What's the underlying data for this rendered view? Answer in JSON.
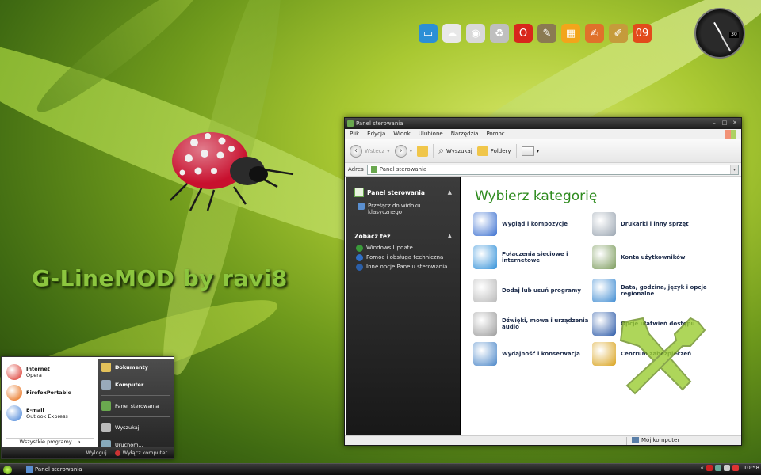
{
  "desktop": {
    "watermark": "G-LineMOD by ravi8"
  },
  "clock": {
    "date": "30"
  },
  "dock": {
    "items": [
      {
        "icon": "monitor-icon",
        "color": "#2b8fd6",
        "glyph": "▭"
      },
      {
        "icon": "cloud-icon",
        "color": "#e8e8e8",
        "glyph": "☁"
      },
      {
        "icon": "disc-icon",
        "color": "#d9d9d9",
        "glyph": "◉"
      },
      {
        "icon": "recycle-bin-icon",
        "color": "#bfbfbf",
        "glyph": "♻"
      },
      {
        "icon": "opera-icon",
        "color": "#d8261c",
        "glyph": "O"
      },
      {
        "icon": "gimp-icon",
        "color": "#8a7a52",
        "glyph": "✎"
      },
      {
        "icon": "film-icon",
        "color": "#f2a51b",
        "glyph": "▦"
      },
      {
        "icon": "pencil-icon",
        "color": "#e0712b",
        "glyph": "✍"
      },
      {
        "icon": "brush-icon",
        "color": "#c59b3b",
        "glyph": "✐"
      },
      {
        "icon": "office-icon",
        "color": "#e24b1b",
        "glyph": "09"
      }
    ]
  },
  "window": {
    "title": "Panel sterowania",
    "menu": [
      "Plik",
      "Edycja",
      "Widok",
      "Ulubione",
      "Narzędzia",
      "Pomoc"
    ],
    "toolbar": {
      "back": "Wstecz",
      "search": "Wyszukaj",
      "folders": "Foldery"
    },
    "address": {
      "label": "Adres",
      "value": "Panel sterowania"
    },
    "sidebar": {
      "panel_title": "Panel sterowania",
      "switch_view": "Przełącz do widoku klasycznego",
      "see_also_title": "Zobacz też",
      "links": [
        "Windows Update",
        "Pomoc i obsługa techniczna",
        "Inne opcje Panelu sterowania"
      ]
    },
    "main": {
      "heading": "Wybierz kategorię",
      "categories": [
        {
          "label": "Wygląd i kompozycje",
          "icon": "appearance-icon",
          "color": "#3a6fd0"
        },
        {
          "label": "Drukarki i inny sprzęt",
          "icon": "printer-icon",
          "color": "#9aa5b1"
        },
        {
          "label": "Połączenia sieciowe i internetowe",
          "icon": "network-icon",
          "color": "#2f8fd8"
        },
        {
          "label": "Konta użytkowników",
          "icon": "users-icon",
          "color": "#7a9a5a"
        },
        {
          "label": "Dodaj lub usuń programy",
          "icon": "add-remove-icon",
          "color": "#b8b8b8"
        },
        {
          "label": "Data, godzina, język i opcje regionalne",
          "icon": "globe-calendar-icon",
          "color": "#3c8ad1"
        },
        {
          "label": "Dźwięki, mowa i urządzenia audio",
          "icon": "speaker-icon",
          "color": "#9c9c9c"
        },
        {
          "label": "Opcje ułatwień dostępu",
          "icon": "accessibility-icon",
          "color": "#2c5aa8"
        },
        {
          "label": "Wydajność i konserwacja",
          "icon": "performance-icon",
          "color": "#4a86c8"
        },
        {
          "label": "Centrum zabezpieczeń",
          "icon": "security-shield-icon",
          "color": "#d9a21b"
        }
      ]
    },
    "status": {
      "location": "Mój komputer"
    }
  },
  "start_menu": {
    "pinned": [
      {
        "title": "Internet",
        "subtitle": "Opera",
        "icon": "opera-icon",
        "color": "#d8261c"
      },
      {
        "title": "FirefoxPortable",
        "subtitle": "",
        "icon": "firefox-icon",
        "color": "#e66000"
      },
      {
        "title": "E-mail",
        "subtitle": "Outlook Express",
        "icon": "mail-icon",
        "color": "#3a7bd5"
      }
    ],
    "all_programs": "Wszystkie programy",
    "right": [
      {
        "label": "Dokumenty",
        "icon": "documents-icon",
        "color": "#e3c15a",
        "bold": true
      },
      {
        "label": "Komputer",
        "icon": "computer-icon",
        "color": "#9ab",
        "bold": true
      },
      {
        "label": "Panel sterowania",
        "icon": "control-panel-icon",
        "color": "#6aa84f",
        "bold": false
      },
      {
        "label": "Wyszukaj",
        "icon": "search-icon",
        "color": "#bbb",
        "bold": false
      },
      {
        "label": "Uruchom...",
        "icon": "run-icon",
        "color": "#8ab",
        "bold": false
      }
    ],
    "logoff": "Wyloguj",
    "shutdown": "Wyłącz komputer"
  },
  "taskbar": {
    "active_task": "Panel sterowania",
    "time": "10:58"
  }
}
